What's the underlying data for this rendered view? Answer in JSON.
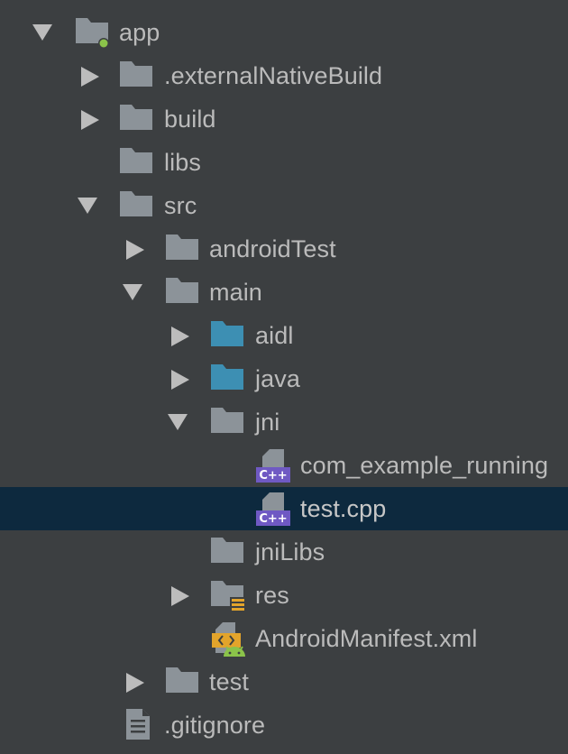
{
  "project_tree": {
    "nodes": [
      {
        "label": "app",
        "icon": "module-folder-icon",
        "expanded": true
      },
      {
        "label": ".externalNativeBuild",
        "icon": "folder-icon",
        "expanded": false
      },
      {
        "label": "build",
        "icon": "folder-icon",
        "expanded": false
      },
      {
        "label": "libs",
        "icon": "folder-icon"
      },
      {
        "label": "src",
        "icon": "folder-icon",
        "expanded": true
      },
      {
        "label": "androidTest",
        "icon": "folder-icon",
        "expanded": false
      },
      {
        "label": "main",
        "icon": "folder-icon",
        "expanded": true
      },
      {
        "label": "aidl",
        "icon": "source-folder-icon",
        "expanded": false
      },
      {
        "label": "java",
        "icon": "source-folder-icon",
        "expanded": false
      },
      {
        "label": "jni",
        "icon": "folder-icon",
        "expanded": true
      },
      {
        "label": "com_example_running",
        "icon": "cpp-file-icon"
      },
      {
        "label": "test.cpp",
        "icon": "cpp-file-icon",
        "selected": true
      },
      {
        "label": "jniLibs",
        "icon": "folder-icon"
      },
      {
        "label": "res",
        "icon": "resource-folder-icon",
        "expanded": false
      },
      {
        "label": "AndroidManifest.xml",
        "icon": "android-manifest-icon"
      },
      {
        "label": "test",
        "icon": "folder-icon",
        "expanded": false
      },
      {
        "label": ".gitignore",
        "icon": "text-file-icon"
      }
    ]
  },
  "colors": {
    "background": "#3c3f41",
    "selected_row": "#0d293e",
    "text": "#bbbbbb",
    "folder": "#8c9399",
    "source_folder": "#3d8fb3",
    "cpp_badge": "#6f59c3",
    "module_dot": "#8bc34a",
    "resource_lines": "#e3a42b",
    "manifest_orange": "#e3a42b",
    "android_green": "#8bc34a"
  }
}
